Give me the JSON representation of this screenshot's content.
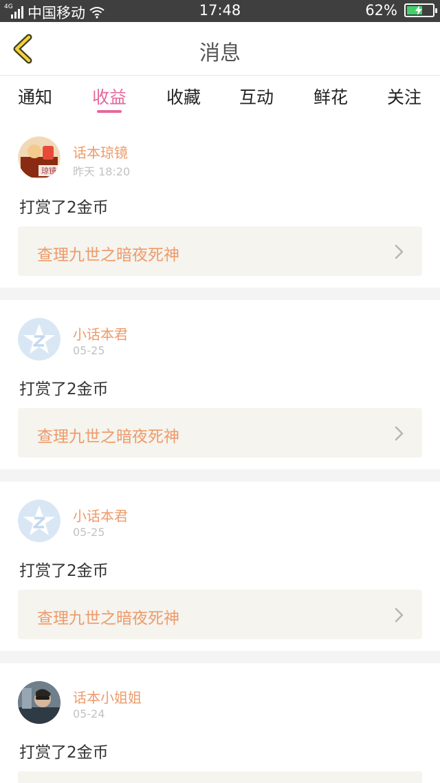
{
  "status_bar": {
    "carrier": "中国移动",
    "network": "4G",
    "time": "17:48",
    "battery": "62%",
    "battery_level": 0.62
  },
  "header": {
    "title": "消息"
  },
  "tabs": [
    {
      "label": "通知"
    },
    {
      "label": "收益"
    },
    {
      "label": "收藏"
    },
    {
      "label": "互动"
    },
    {
      "label": "鲜花"
    },
    {
      "label": "关注"
    }
  ],
  "active_tab": "收益",
  "colors": {
    "accent": "#e5689b",
    "name_orange": "#ee9a6a",
    "story_bg": "#f5f4ee"
  },
  "messages": [
    {
      "user": "话本琼镜",
      "time": "昨天 18:20",
      "avatar_text": "琼镜",
      "text": "打赏了2金币",
      "story": "查理九世之暗夜死神"
    },
    {
      "user": "小话本君",
      "time": "05-25",
      "text": "打赏了2金币",
      "story": "查理九世之暗夜死神"
    },
    {
      "user": "小话本君",
      "time": "05-25",
      "text": "打赏了2金币",
      "story": "查理九世之暗夜死神"
    },
    {
      "user": "话本小姐姐",
      "time": "05-24",
      "text": "打赏了2金币"
    }
  ]
}
